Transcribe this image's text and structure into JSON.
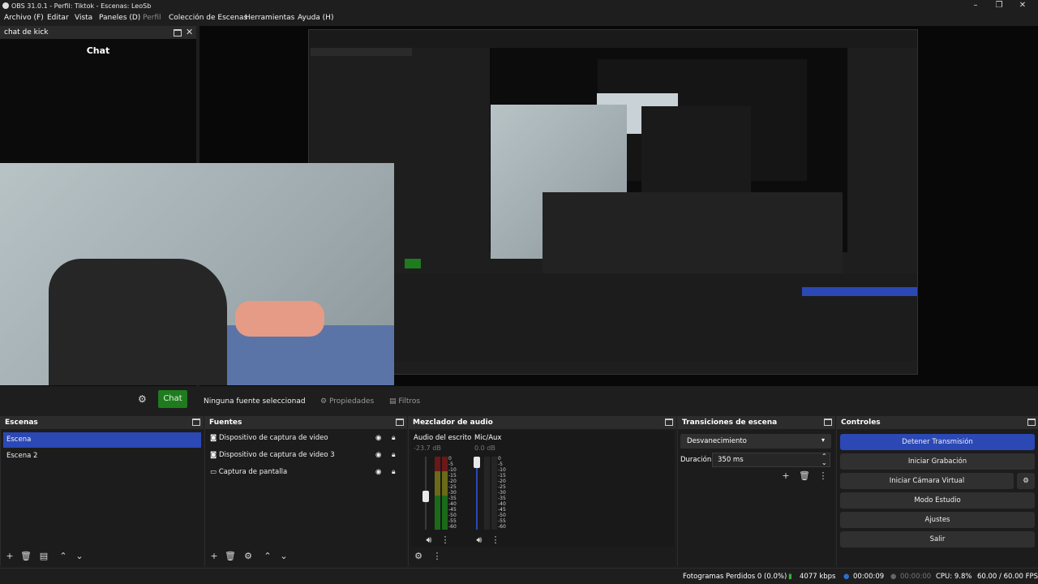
{
  "window": {
    "title": "OBS 31.0.1 - Perfil: Tiktok - Escenas: LeoSb"
  },
  "menu": [
    {
      "label": "Archivo (F)",
      "enabled": true
    },
    {
      "label": "Editar",
      "enabled": true
    },
    {
      "label": "Vista",
      "enabled": true
    },
    {
      "label": "Paneles (D)",
      "enabled": true
    },
    {
      "label": "Perfil",
      "enabled": false
    },
    {
      "label": "Colección de Escenas",
      "enabled": true
    },
    {
      "label": "Herramientas",
      "enabled": true
    },
    {
      "label": "Ayuda (H)",
      "enabled": true
    }
  ],
  "chat_dock": {
    "title": "chat de kick",
    "heading": "Chat"
  },
  "preview_toolbar": {
    "chat_button": "Chat",
    "no_source": "Ninguna fuente seleccionad",
    "properties": "Propiedades",
    "filters": "Filtros"
  },
  "scenes": {
    "title": "Escenas",
    "items": [
      "Escena",
      "Escena 2"
    ],
    "selected_index": 0
  },
  "sources": {
    "title": "Fuentes",
    "items": [
      {
        "label": "Dispositivo de captura de video",
        "icon": "camera-icon"
      },
      {
        "label": "Dispositivo de captura de video 3",
        "icon": "camera-icon"
      },
      {
        "label": "Captura de pantalla",
        "icon": "monitor-icon"
      }
    ]
  },
  "mixer": {
    "title": "Mezclador de audio",
    "channels": [
      {
        "name": "Audio del escrito",
        "db": "-23.7 dB",
        "fader_level": 0.45
      },
      {
        "name": "Mic/Aux",
        "db": "0.0 dB",
        "fader_level": 1.0
      }
    ],
    "scale": [
      "0",
      "-5",
      "-10",
      "-15",
      "-20",
      "-25",
      "-30",
      "-35",
      "-40",
      "-45",
      "-50",
      "-55",
      "-60"
    ]
  },
  "transitions": {
    "title": "Transiciones de escena",
    "selected": "Desvanecimiento",
    "duration_label": "Duración",
    "duration_value": "350 ms"
  },
  "controls": {
    "title": "Controles",
    "buttons": [
      {
        "label": "Detener Transmisión",
        "primary": true
      },
      {
        "label": "Iniciar Grabación",
        "primary": false
      },
      {
        "label": "Iniciar Cámara Virtual",
        "primary": false
      },
      {
        "label": "Modo Estudio",
        "primary": false
      },
      {
        "label": "Ajustes",
        "primary": false
      },
      {
        "label": "Salir",
        "primary": false
      }
    ]
  },
  "status": {
    "dropped": "Fotogramas Perdidos 0 (0.0%)",
    "bitrate": "4077 kbps",
    "stream_time": "00:00:09",
    "rec_time": "00:00:00",
    "cpu": "CPU: 9.8%",
    "fps": "60.00 / 60.00 FPS"
  },
  "colors": {
    "accent": "#2b48b5",
    "chat_green": "#1e7b1e",
    "status_green": "#2fb52f"
  }
}
